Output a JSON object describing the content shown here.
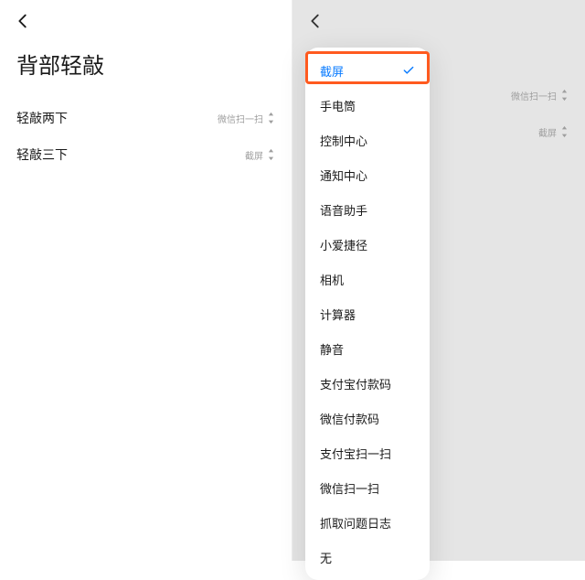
{
  "left": {
    "title": "背部轻敲",
    "rows": [
      {
        "label": "轻敲两下",
        "value": "微信扫一扫"
      },
      {
        "label": "轻敲三下",
        "value": "截屏"
      }
    ]
  },
  "right": {
    "rows": [
      {
        "label": "",
        "value": "微信扫一扫"
      },
      {
        "label": "",
        "value": "截屏"
      }
    ]
  },
  "popup": {
    "selected_index": 0,
    "options": [
      "截屏",
      "手电筒",
      "控制中心",
      "通知中心",
      "语音助手",
      "小爱捷径",
      "相机",
      "计算器",
      "静音",
      "支付宝付款码",
      "微信付款码",
      "支付宝扫一扫",
      "微信扫一扫",
      "抓取问题日志",
      "无"
    ]
  },
  "colors": {
    "accent": "#0b7cff",
    "highlight": "#ff5a1f"
  }
}
